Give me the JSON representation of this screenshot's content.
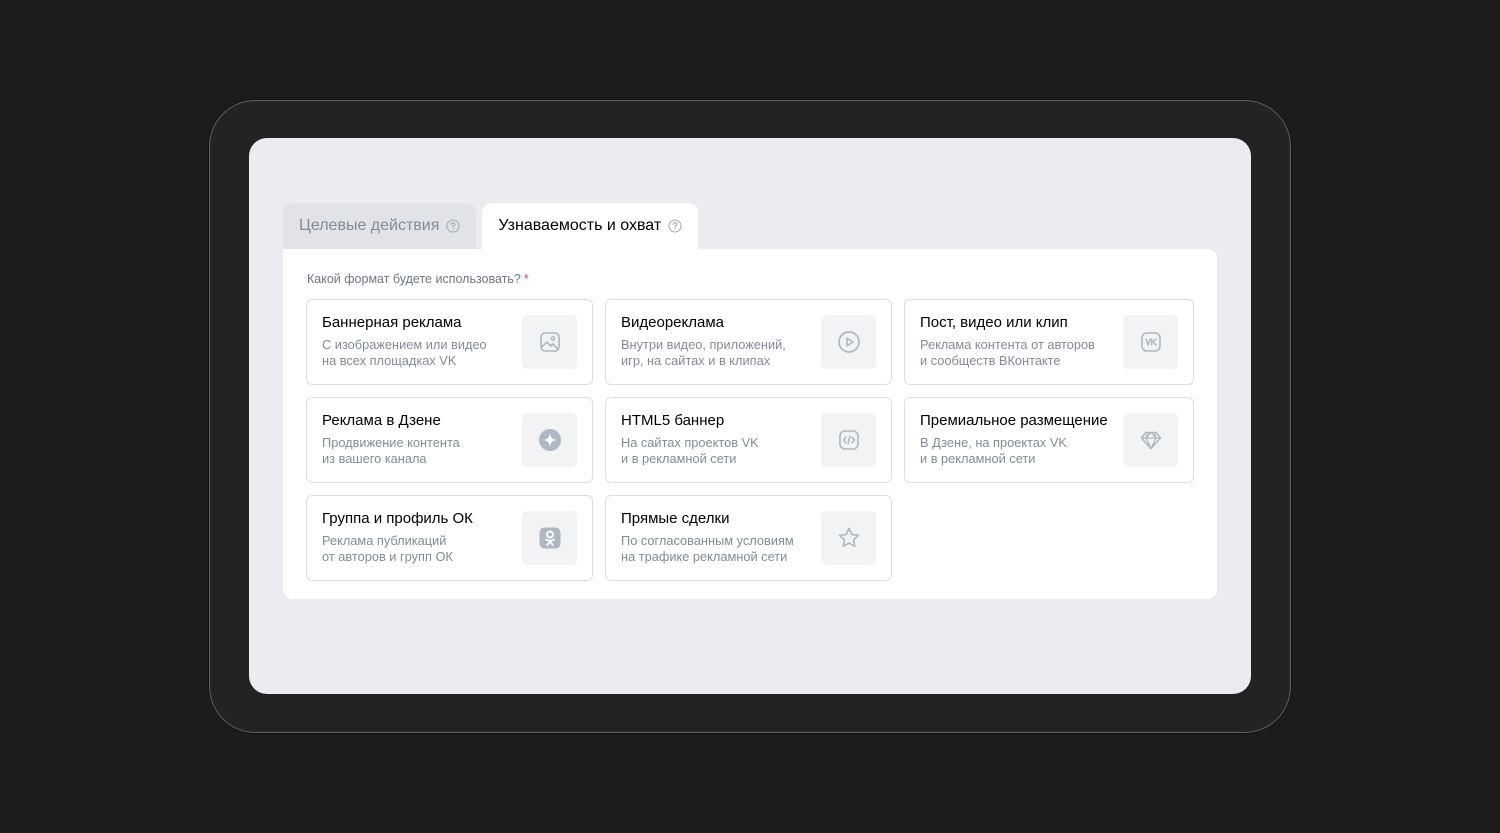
{
  "tabs": [
    {
      "label": "Целевые действия",
      "active": false,
      "icon": "help-circle-icon"
    },
    {
      "label": "Узнаваемость и охват",
      "active": true,
      "icon": "help-circle-icon"
    }
  ],
  "form": {
    "question": "Какой формат будете использовать?",
    "required_mark": "*"
  },
  "formats": [
    {
      "title": "Баннерная реклама",
      "desc_line1": "С изображением или видео",
      "desc_line2": "на всех площадках VK",
      "icon": "image-icon"
    },
    {
      "title": "Видеореклама",
      "desc_line1": "Внутри видео, приложений,",
      "desc_line2": "игр, на сайтах и в клипах",
      "icon": "play-circle-icon"
    },
    {
      "title": "Пост, видео или клип",
      "desc_line1": "Реклама контента от авторов",
      "desc_line2": "и сообществ ВКонтакте",
      "icon": "vk-logo-icon"
    },
    {
      "title": "Реклама в Дзене",
      "desc_line1": "Продвижение контента",
      "desc_line2": "из вашего канала",
      "icon": "dzen-logo-icon"
    },
    {
      "title": "HTML5 баннер",
      "desc_line1": "На сайтах проектов VK",
      "desc_line2": "и в рекламной сети",
      "icon": "code-icon"
    },
    {
      "title": "Премиальное размещение",
      "desc_line1": "В Дзене, на проектах VK",
      "desc_line2": "и в рекламной сети",
      "icon": "diamond-icon"
    },
    {
      "title": "Группа и профиль ОК",
      "desc_line1": "Реклама публикаций",
      "desc_line2": "от авторов и групп ОК",
      "icon": "ok-logo-icon"
    },
    {
      "title": "Прямые сделки",
      "desc_line1": "По согласованным условиям",
      "desc_line2": "на трафике рекламной сети",
      "icon": "star-icon"
    }
  ],
  "colors": {
    "background": "#1c1c1c",
    "screen": "#ebecef",
    "panel": "#ffffff",
    "text_primary": "#000000",
    "text_secondary": "#818c99",
    "icon_gray": "#aeb7c2",
    "required": "#e64646"
  }
}
